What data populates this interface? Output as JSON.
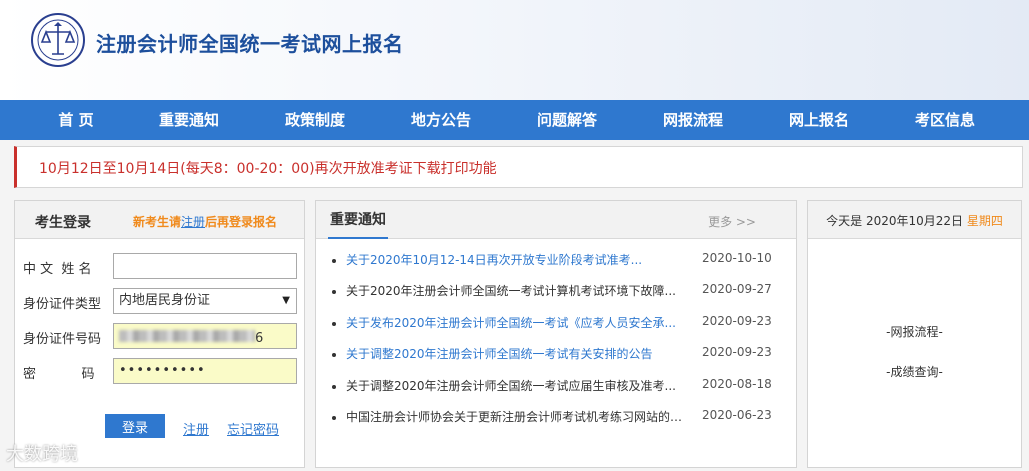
{
  "header": {
    "site_title": "注册会计师全国统一考试网上报名"
  },
  "nav": [
    "首 页",
    "重要通知",
    "政策制度",
    "地方公告",
    "问题解答",
    "网报流程",
    "网上报名",
    "考区信息"
  ],
  "notice": "10月12日至10月14日(每天8：00-20：00)再次开放准考证下载打印功能",
  "login": {
    "title": "考生登录",
    "hint_prefix": "新考生请",
    "hint_link": "注册",
    "hint_suffix": "后再登录报名",
    "name_label": "中 文  姓 名",
    "name_value": "",
    "id_type_label": "身份证件类型",
    "id_type_value": "内地居民身份证",
    "id_no_label": "身份证件号码",
    "id_no_tail": "6",
    "pwd_label": "密           码",
    "pwd_value": "••••••••••",
    "login_button": "登录",
    "register_link": "注册",
    "forgot_link": "忘记密码"
  },
  "news": {
    "title": "重要通知",
    "more": "更多 >>",
    "items": [
      {
        "title": "关于2020年10月12-14日再次开放专业阶段考试准考...",
        "date": "2020-10-10",
        "highlight": true
      },
      {
        "title": "关于2020年注册会计师全国统一考试计算机考试环境下故障...",
        "date": "2020-09-27",
        "highlight": false
      },
      {
        "title": "关于发布2020年注册会计师全国统一考试《应考人员安全承...",
        "date": "2020-09-23",
        "highlight": true
      },
      {
        "title": "关于调整2020年注册会计师全国统一考试有关安排的公告",
        "date": "2020-09-23",
        "highlight": true
      },
      {
        "title": "关于调整2020年注册会计师全国统一考试应届生审核及准考...",
        "date": "2020-08-18",
        "highlight": false
      },
      {
        "title": "中国注册会计师协会关于更新注册会计师考试机考练习网站的公...",
        "date": "2020-06-23",
        "highlight": false
      }
    ]
  },
  "side": {
    "today_prefix": "今天是 2020年10月22日",
    "weekday": "星期四",
    "links": [
      "-网报流程-",
      "-成绩查询-"
    ]
  },
  "watermark": "大数跨境",
  "colors": {
    "nav_bg": "#2f78cf",
    "title": "#1d4f9c",
    "notice": "#c9302c",
    "accent": "#f08a1c"
  }
}
